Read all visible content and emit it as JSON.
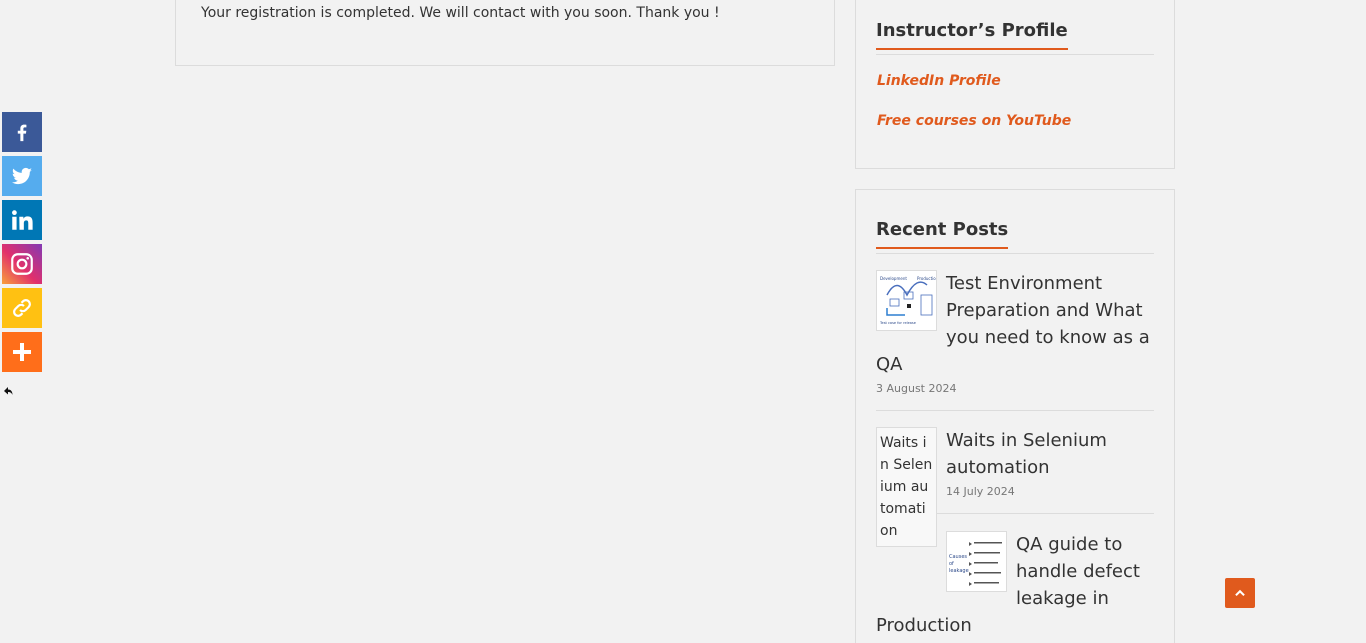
{
  "main": {
    "message": "Your registration is completed. We will contact with you soon. Thank you !"
  },
  "instructor_widget": {
    "title": "Instructor’s Profile",
    "links": [
      {
        "label": "LinkedIn Profile"
      },
      {
        "label": "Free courses on YouTube"
      }
    ]
  },
  "recent_posts": {
    "title": "Recent Posts",
    "posts": [
      {
        "title": "Test Environment Preparation and What you need to know as a QA",
        "date": "3 August 2024"
      },
      {
        "title": "Waits in Selenium automation",
        "date": "14 July 2024",
        "thumb_text": "Waits in Selenium automation"
      },
      {
        "title": "QA guide to handle defect leakage in Production"
      }
    ]
  },
  "social": {
    "buttons": [
      {
        "name": "facebook",
        "icon": "facebook-icon",
        "color": "#3b5998"
      },
      {
        "name": "twitter",
        "icon": "twitter-icon",
        "color": "#55acee"
      },
      {
        "name": "linkedin",
        "icon": "linkedin-icon",
        "color": "#0077b5"
      },
      {
        "name": "instagram",
        "icon": "instagram-icon",
        "color": "#e1306c"
      },
      {
        "name": "copy-link",
        "icon": "link-icon",
        "color": "#ffc112"
      },
      {
        "name": "more",
        "icon": "plus-icon",
        "color": "#ff6e1a"
      }
    ]
  },
  "colors": {
    "accent": "#e05a1d",
    "background": "#f2f2f2"
  }
}
